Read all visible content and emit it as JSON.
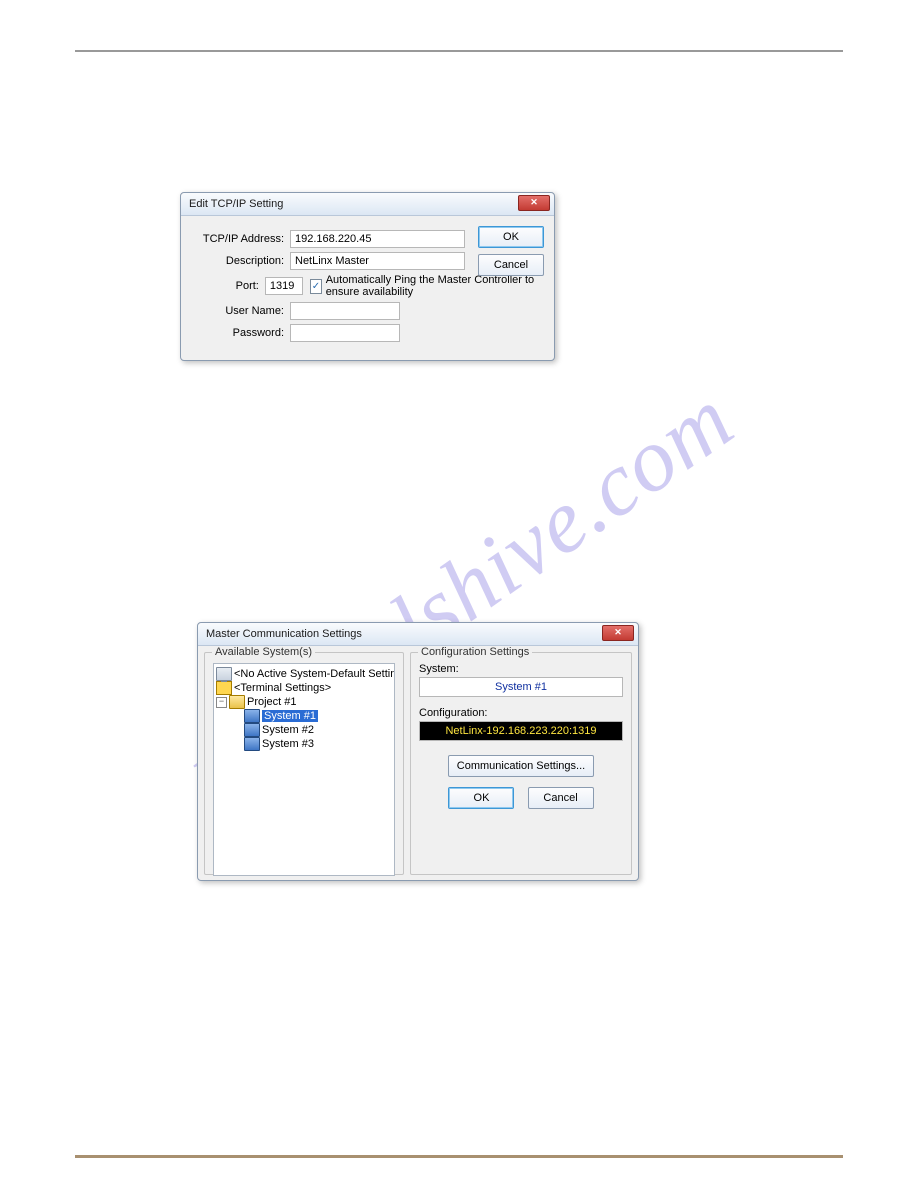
{
  "dialog1": {
    "title": "Edit TCP/IP Setting",
    "close": "✕",
    "labels": {
      "address": "TCP/IP Address:",
      "description": "Description:",
      "port": "Port:",
      "username": "User Name:",
      "password": "Password:"
    },
    "values": {
      "address": "192.168.220.45",
      "description": "NetLinx Master",
      "port": "1319",
      "username": "",
      "password": ""
    },
    "autoping_checked": true,
    "autoping_label": "Automatically Ping the Master Controller to ensure availability",
    "buttons": {
      "ok": "OK",
      "cancel": "Cancel"
    }
  },
  "dialog2": {
    "title": "Master Communication Settings",
    "close": "✕",
    "available_title": "Available System(s)",
    "config_title": "Configuration Settings",
    "tree": {
      "no_active": "<No Active System-Default Settings>",
      "terminal": "<Terminal Settings>",
      "project": "Project #1",
      "sys1": "System #1",
      "sys2": "System #2",
      "sys3": "System #3"
    },
    "system_label": "System:",
    "system_value": "System #1",
    "configuration_label": "Configuration:",
    "configuration_value": "NetLinx-192.168.223.220:1319",
    "comm_button": "Communication Settings...",
    "buttons": {
      "ok": "OK",
      "cancel": "Cancel"
    }
  }
}
